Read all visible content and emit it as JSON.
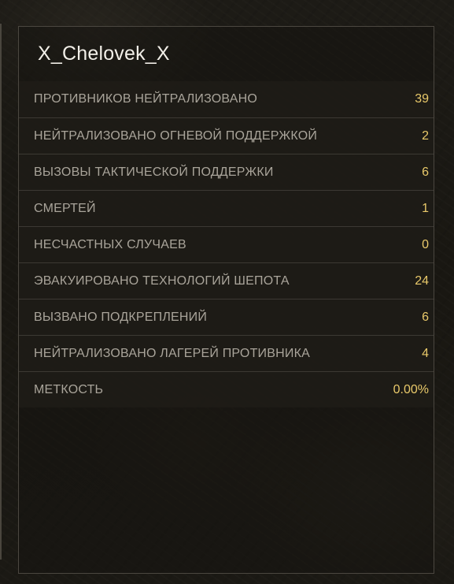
{
  "player": {
    "name": "X_Chelovek_X"
  },
  "stats": [
    {
      "label": "ПРОТИВНИКОВ НЕЙТРАЛИЗОВАНО",
      "value": "39"
    },
    {
      "label": "НЕЙТРАЛИЗОВАНО ОГНЕВОЙ ПОДДЕРЖКОЙ",
      "value": "2"
    },
    {
      "label": "ВЫЗОВЫ ТАКТИЧЕСКОЙ ПОДДЕРЖКИ",
      "value": "6"
    },
    {
      "label": "СМЕРТЕЙ",
      "value": "1"
    },
    {
      "label": "НЕСЧАСТНЫХ СЛУЧАЕВ",
      "value": "0"
    },
    {
      "label": "ЭВАКУИРОВАНО ТЕХНОЛОГИЙ ШЕПОТА",
      "value": "24"
    },
    {
      "label": "ВЫЗВАНО ПОДКРЕПЛЕНИЙ",
      "value": "6"
    },
    {
      "label": "НЕЙТРАЛИЗОВАНО ЛАГЕРЕЙ ПРОТИВНИКА",
      "value": "4"
    },
    {
      "label": "МЕТКОСТЬ",
      "value": "0.00%"
    }
  ],
  "colors": {
    "background": "#1a1813",
    "row_background": "#1e1c17",
    "label_text": "#a9a49a",
    "value_text": "#e9c96a",
    "name_text": "#f2efe8",
    "border": "#4b4740"
  }
}
